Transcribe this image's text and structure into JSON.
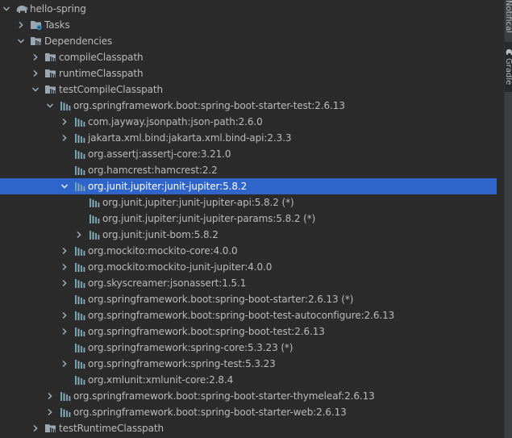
{
  "colors": {
    "background": "#2b2b2b",
    "selection": "#2f65ca",
    "text": "#bbbbbb",
    "folder": "#9aa7b0",
    "library": "#67a8b6",
    "chevron": "#a9b7c6"
  },
  "tree": [
    {
      "label": "hello-spring",
      "depth": 0,
      "expand": "expanded",
      "icon": "gradle-elephant-icon"
    },
    {
      "label": "Tasks",
      "depth": 1,
      "expand": "collapsed",
      "icon": "tasks-folder-icon"
    },
    {
      "label": "Dependencies",
      "depth": 1,
      "expand": "expanded",
      "icon": "dependencies-folder-icon"
    },
    {
      "label": "compileClasspath",
      "depth": 2,
      "expand": "collapsed",
      "icon": "configuration-folder-icon"
    },
    {
      "label": "runtimeClasspath",
      "depth": 2,
      "expand": "collapsed",
      "icon": "configuration-folder-icon"
    },
    {
      "label": "testCompileClasspath",
      "depth": 2,
      "expand": "expanded",
      "icon": "configuration-folder-icon"
    },
    {
      "label": "org.springframework.boot:spring-boot-starter-test:2.6.13",
      "depth": 3,
      "expand": "expanded",
      "icon": "library-icon"
    },
    {
      "label": "com.jayway.jsonpath:json-path:2.6.0",
      "depth": 4,
      "expand": "collapsed",
      "icon": "library-icon"
    },
    {
      "label": "jakarta.xml.bind:jakarta.xml.bind-api:2.3.3",
      "depth": 4,
      "expand": "collapsed",
      "icon": "library-icon"
    },
    {
      "label": "org.assertj:assertj-core:3.21.0",
      "depth": 4,
      "expand": "none",
      "icon": "library-icon"
    },
    {
      "label": "org.hamcrest:hamcrest:2.2",
      "depth": 4,
      "expand": "none",
      "icon": "library-icon"
    },
    {
      "label": "org.junit.jupiter:junit-jupiter:5.8.2",
      "depth": 4,
      "expand": "expanded",
      "icon": "library-icon",
      "selected": true
    },
    {
      "label": "org.junit.jupiter:junit-jupiter-api:5.8.2 (*)",
      "depth": 5,
      "expand": "none",
      "icon": "library-icon"
    },
    {
      "label": "org.junit.jupiter:junit-jupiter-params:5.8.2 (*)",
      "depth": 5,
      "expand": "none",
      "icon": "library-icon"
    },
    {
      "label": "org.junit:junit-bom:5.8.2",
      "depth": 5,
      "expand": "collapsed",
      "icon": "library-icon"
    },
    {
      "label": "org.mockito:mockito-core:4.0.0",
      "depth": 4,
      "expand": "collapsed",
      "icon": "library-icon"
    },
    {
      "label": "org.mockito:mockito-junit-jupiter:4.0.0",
      "depth": 4,
      "expand": "collapsed",
      "icon": "library-icon"
    },
    {
      "label": "org.skyscreamer:jsonassert:1.5.1",
      "depth": 4,
      "expand": "collapsed",
      "icon": "library-icon"
    },
    {
      "label": "org.springframework.boot:spring-boot-starter:2.6.13 (*)",
      "depth": 4,
      "expand": "none",
      "icon": "library-icon"
    },
    {
      "label": "org.springframework.boot:spring-boot-test-autoconfigure:2.6.13",
      "depth": 4,
      "expand": "collapsed",
      "icon": "library-icon"
    },
    {
      "label": "org.springframework.boot:spring-boot-test:2.6.13",
      "depth": 4,
      "expand": "collapsed",
      "icon": "library-icon"
    },
    {
      "label": "org.springframework:spring-core:5.3.23 (*)",
      "depth": 4,
      "expand": "none",
      "icon": "library-icon"
    },
    {
      "label": "org.springframework:spring-test:5.3.23",
      "depth": 4,
      "expand": "collapsed",
      "icon": "library-icon"
    },
    {
      "label": "org.xmlunit:xmlunit-core:2.8.4",
      "depth": 4,
      "expand": "none",
      "icon": "library-icon"
    },
    {
      "label": "org.springframework.boot:spring-boot-starter-thymeleaf:2.6.13",
      "depth": 3,
      "expand": "collapsed",
      "icon": "library-icon"
    },
    {
      "label": "org.springframework.boot:spring-boot-starter-web:2.6.13",
      "depth": 3,
      "expand": "collapsed",
      "icon": "library-icon"
    },
    {
      "label": "testRuntimeClasspath",
      "depth": 2,
      "expand": "collapsed",
      "icon": "configuration-folder-icon"
    }
  ],
  "side_tabs": [
    {
      "label": "Notifications",
      "icon": "bell-icon",
      "active": false
    },
    {
      "label": "Gradle",
      "icon": "gradle-elephant-icon",
      "active": true
    }
  ]
}
